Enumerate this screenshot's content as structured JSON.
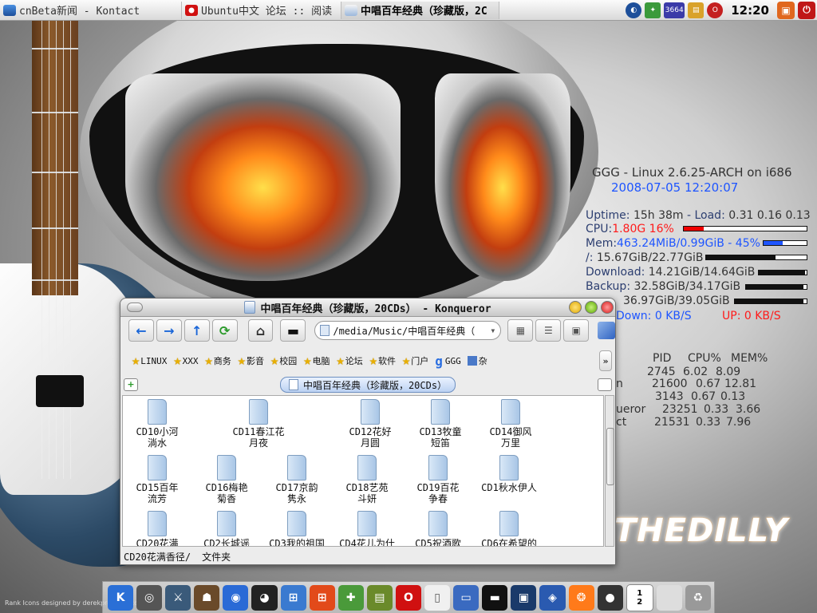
{
  "colors": {
    "blue": "#1e55ff",
    "red": "#ff1a1a",
    "panel": "#e8e8e8",
    "accent": "#1a66d8"
  },
  "taskbar": {
    "tasks": [
      {
        "label": "cnBeta新闻 - Kontact",
        "icon": "kontact-icon"
      },
      {
        "label": "Ubuntu中文 论坛 :: 阅读",
        "icon": "opera-icon"
      },
      {
        "label": "中唱百年经典（珍藏版，2C",
        "icon": "konqueror-icon"
      }
    ],
    "tray_number": "3664",
    "clock": "12:20"
  },
  "conky": {
    "header": "GGG - Linux 2.6.25-ARCH on i686",
    "datetime": "2008-07-05 12:20:07",
    "uptime_label": "Uptime:",
    "uptime_value": "15h 38m",
    "load_label": "- Load:",
    "load_value": "0.31 0.16 0.13",
    "cpu_label": "CPU:",
    "cpu_value": "1.80G  16%",
    "cpu_frac": 0.16,
    "mem_label": "Mem:",
    "mem_value": "463.24MiB/0.99GiB - 45%",
    "mem_frac": 0.45,
    "root_label": "/:",
    "root_value": "15.67GiB/22.77GiB",
    "root_frac": 0.69,
    "download_label": "Download:",
    "download_value": "14.21GiB/14.64GiB",
    "download_frac": 0.97,
    "backup_label": "Backup:",
    "backup_value": "32.58GiB/34.17GiB",
    "backup_frac": 0.95,
    "media_value": "36.97GiB/39.05GiB",
    "media_frac": 0.95,
    "down_label": "Down: 0 KB/S",
    "up_label": "UP: 0 KB/S",
    "proc_header": {
      "pid": "PID",
      "cpu": "CPU%",
      "mem": "MEM%"
    },
    "procs": [
      {
        "name": "",
        "pid": "2745",
        "cpu": "6.02",
        "mem": "8.09"
      },
      {
        "name": "n",
        "pid": "21600",
        "cpu": "0.67",
        "mem": "12.81"
      },
      {
        "name": "",
        "pid": "3143",
        "cpu": "0.67",
        "mem": "0.13"
      },
      {
        "name": "ueror",
        "pid": "23251",
        "cpu": "0.33",
        "mem": "3.66"
      },
      {
        "name": "ct",
        "pid": "21531",
        "cpu": "0.33",
        "mem": "7.96"
      }
    ]
  },
  "wallpaper": {
    "brand": "THEDILLY",
    "credit": "Rank Icons designed by derekprospero.com"
  },
  "konqueror": {
    "title": "中唱百年经典（珍藏版，20CDs） - Konqueror",
    "location": "/media/Music/中唱百年经典（",
    "bookmarks": [
      "LINUX",
      "XXX",
      "商务",
      "影音",
      "校园",
      "电脑",
      "论坛",
      "软件",
      "门户",
      "GGG",
      "杂"
    ],
    "tab_label": "中唱百年经典（珍藏版，20CDs）",
    "folders": [
      [
        "CD10小河",
        "淌水"
      ],
      [
        "CD11春江花",
        "月夜"
      ],
      [
        "CD12花好",
        "月圆"
      ],
      [
        "CD13牧童",
        "短笛"
      ],
      [
        "CD14御风",
        "万里"
      ],
      [
        "CD15百年",
        "流芳"
      ],
      [
        "CD16梅艳",
        "菊香"
      ],
      [
        "CD17京韵",
        "隽永"
      ],
      [
        "CD18艺苑",
        "斗妍"
      ],
      [
        "CD19百花",
        "争春"
      ],
      [
        "CD1秋水伊人",
        ""
      ],
      [
        "CD20花满",
        ""
      ],
      [
        "CD2长城谣",
        ""
      ],
      [
        "CD3我的祖国",
        ""
      ],
      [
        "CD4花儿为什",
        ""
      ],
      [
        "CD5祝酒歌",
        ""
      ],
      [
        "CD6在希望的",
        ""
      ]
    ],
    "status_name": "CD20花满香径/",
    "status_type": "文件夹"
  },
  "dock": [
    "kde-icon",
    "gamepad-icon",
    "counter-strike-icon",
    "warcraft-icon",
    "google-earth-icon",
    "qq-icon",
    "network-icon",
    "windows-icon",
    "cross-icon",
    "books-icon",
    "opera-icon",
    "document-icon",
    "monitor-icon",
    "terminal-icon",
    "display-icon",
    "konqueror-icon",
    "firefox-icon",
    "traffic-light-icon",
    "pager-icon",
    "mixer-icon",
    "trash-icon"
  ],
  "pager": {
    "desk1": "1",
    "desk2": "2"
  }
}
